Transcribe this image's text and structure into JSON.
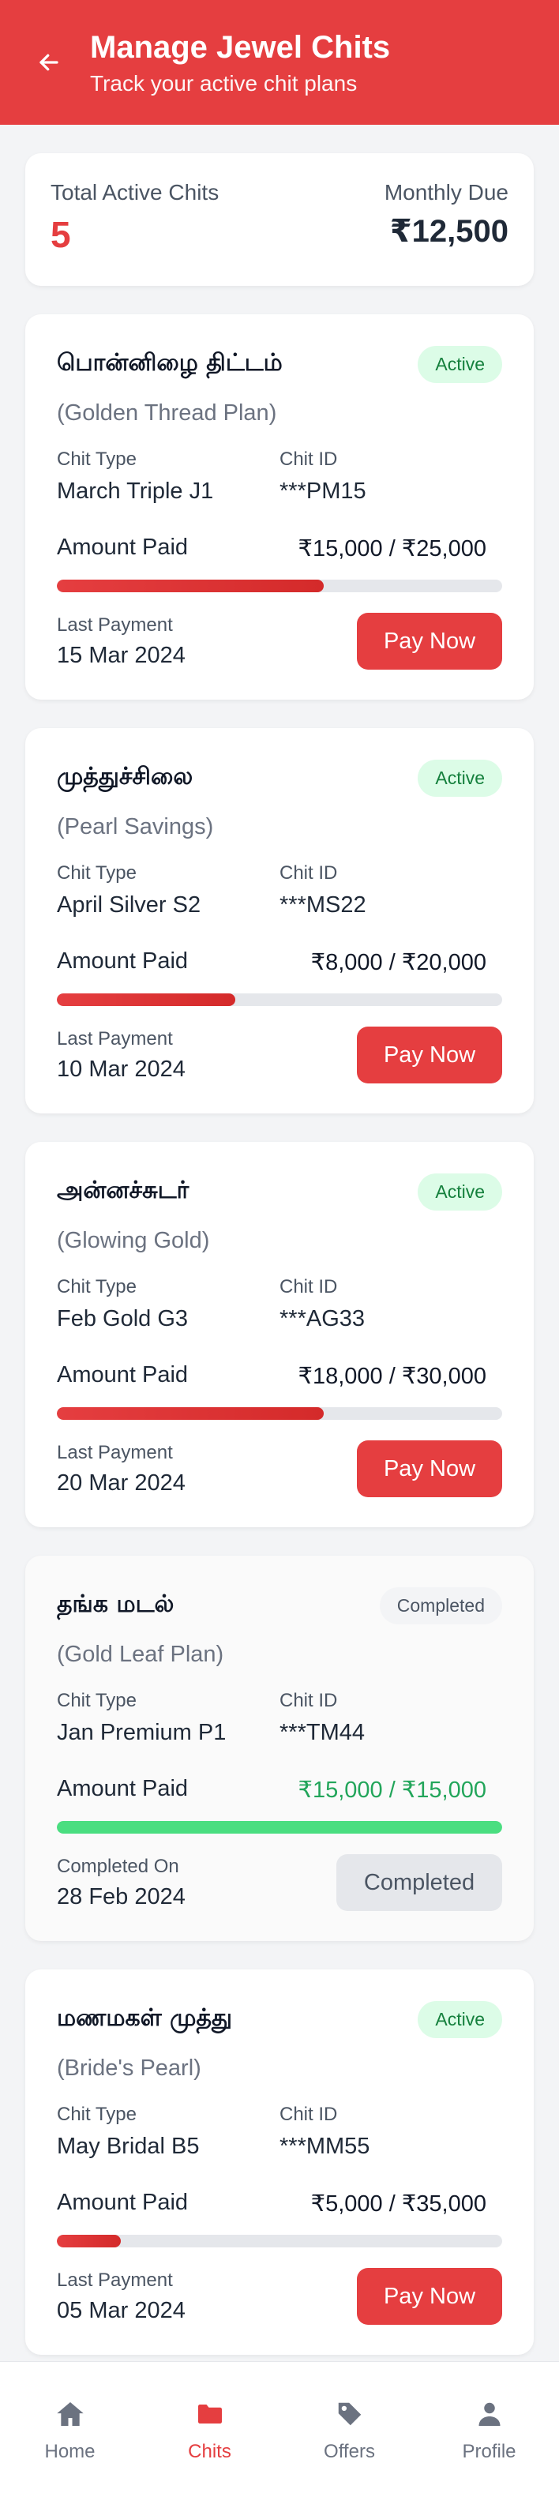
{
  "header": {
    "title": "Manage Jewel Chits",
    "subtitle": "Track your active chit plans"
  },
  "summary": {
    "total_label": "Total Active Chits",
    "total_value": "5",
    "due_label": "Monthly Due",
    "due_value": "₹12,500"
  },
  "labels": {
    "chit_type": "Chit Type",
    "chit_id": "Chit ID",
    "amount_paid": "Amount Paid",
    "last_payment": "Last Payment",
    "completed_on": "Completed On"
  },
  "chits": [
    {
      "name": "பொன்னிழை திட்டம்",
      "subtitle": "(Golden Thread Plan)",
      "status": "Active",
      "type": "March Triple J1",
      "id": "***PM15",
      "amount": "₹15,000 / ₹25,000",
      "progress": 0.6,
      "date_label": "Last Payment",
      "date": "15 Mar 2024",
      "button": "Pay Now"
    },
    {
      "name": "முத்துச்சிலை",
      "subtitle": "(Pearl Savings)",
      "status": "Active",
      "type": "April Silver S2",
      "id": "***MS22",
      "amount": "₹8,000 / ₹20,000",
      "progress": 0.4,
      "date_label": "Last Payment",
      "date": "10 Mar 2024",
      "button": "Pay Now"
    },
    {
      "name": "அன்னச்சுடர்",
      "subtitle": "(Glowing Gold)",
      "status": "Active",
      "type": "Feb Gold G3",
      "id": "***AG33",
      "amount": "₹18,000 / ₹30,000",
      "progress": 0.6,
      "date_label": "Last Payment",
      "date": "20 Mar 2024",
      "button": "Pay Now"
    },
    {
      "name": "தங்க மடல்",
      "subtitle": "(Gold Leaf Plan)",
      "status": "Completed",
      "type": "Jan Premium P1",
      "id": "***TM44",
      "amount": "₹15,000 / ₹15,000",
      "progress": 1.0,
      "date_label": "Completed On",
      "date": "28 Feb 2024",
      "button": "Completed"
    },
    {
      "name": "மணமகள் முத்து",
      "subtitle": "(Bride's Pearl)",
      "status": "Active",
      "type": "May Bridal B5",
      "id": "***MM55",
      "amount": "₹5,000 / ₹35,000",
      "progress": 0.143,
      "date_label": "Last Payment",
      "date": "05 Mar 2024",
      "button": "Pay Now"
    }
  ],
  "nav": [
    {
      "label": "Home",
      "icon": "home-icon",
      "active": false
    },
    {
      "label": "Chits",
      "icon": "folder-icon",
      "active": true
    },
    {
      "label": "Offers",
      "icon": "tag-icon",
      "active": false
    },
    {
      "label": "Profile",
      "icon": "user-icon",
      "active": false
    }
  ],
  "colors": {
    "accent": "#e53e40",
    "success": "#22a55a",
    "progress_complete": "#4ade80"
  }
}
